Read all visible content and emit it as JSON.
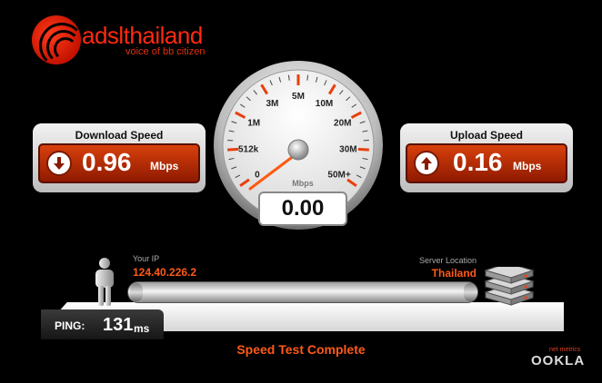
{
  "brand": {
    "name": "adslthailand",
    "tagline": "voice of bb citizen"
  },
  "download": {
    "title": "Download Speed",
    "value": "0.96",
    "unit": "Mbps"
  },
  "upload": {
    "title": "Upload Speed",
    "value": "0.16",
    "unit": "Mbps"
  },
  "gauge": {
    "ticks": [
      "0",
      "512k",
      "1M",
      "3M",
      "5M",
      "10M",
      "20M",
      "30M",
      "50M+"
    ],
    "unit": "Mbps",
    "readout": "0.00"
  },
  "client": {
    "ip_label": "Your IP",
    "ip": "124.40.226.2"
  },
  "server": {
    "label": "Server Location",
    "location": "Thailand"
  },
  "ping": {
    "label": "PING:",
    "value": "131",
    "unit": "ms"
  },
  "status": "Speed Test Complete",
  "footer": {
    "network": "net metrics",
    "provider": "OOKLA"
  },
  "colors": {
    "accent": "#ff4a10",
    "panel_red": "#c53408"
  }
}
